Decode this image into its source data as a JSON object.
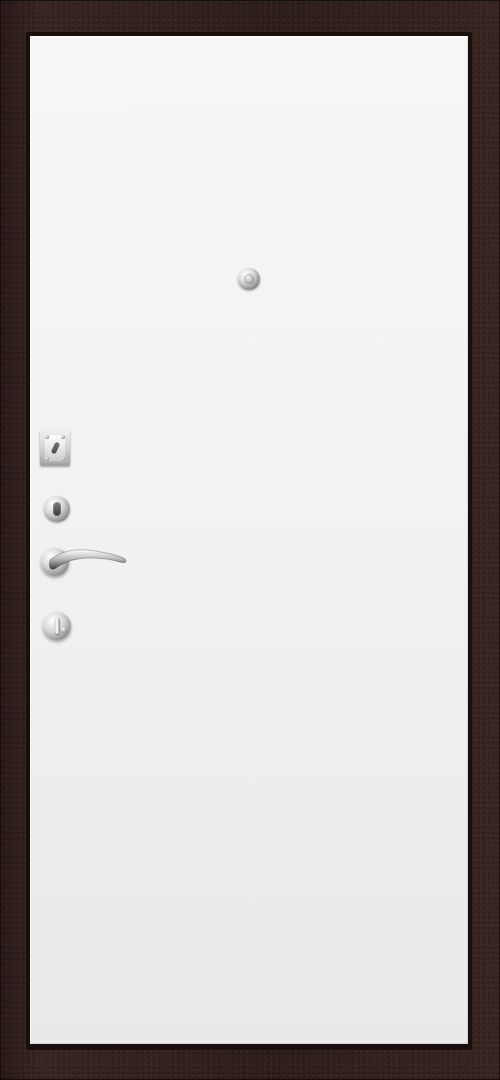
{
  "scene": {
    "type": "interior-door",
    "colors": {
      "frame": "#2f1f1b",
      "panel": "#f2f2f2",
      "hardware": "#c9c9c9"
    },
    "hardware": {
      "peephole": {
        "icon": "peephole-icon"
      },
      "upper_lock": {
        "icon": "lock-plate-icon"
      },
      "cylinder": {
        "icon": "cylinder-icon"
      },
      "handle": {
        "icon": "door-handle-icon"
      },
      "thumbturn": {
        "icon": "thumbturn-icon"
      }
    }
  }
}
